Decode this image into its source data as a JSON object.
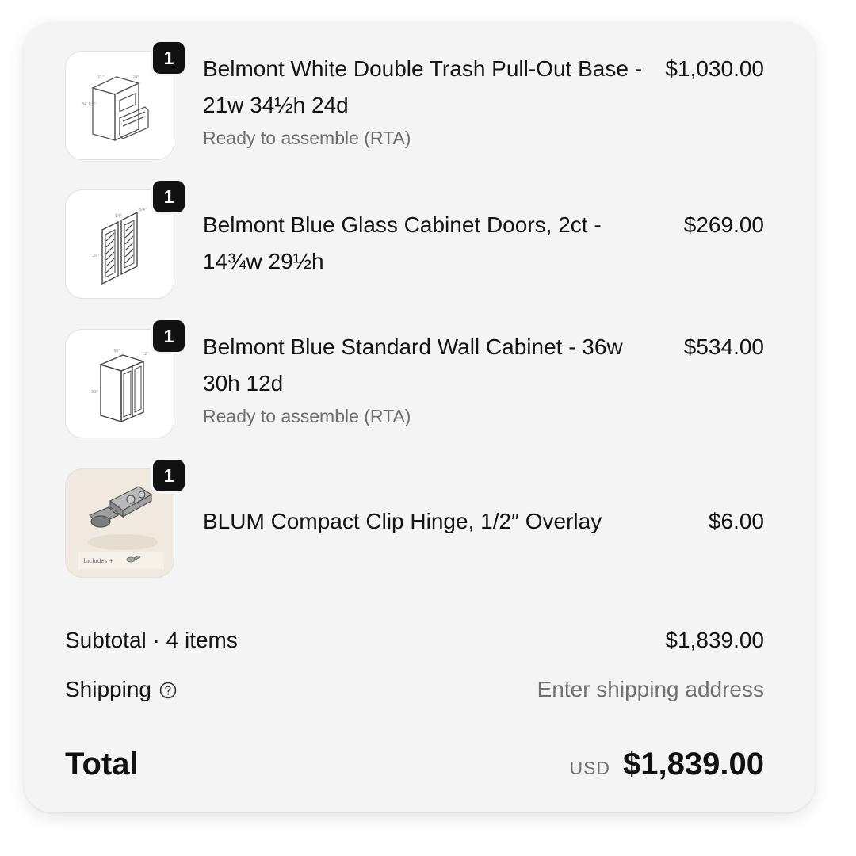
{
  "items": [
    {
      "quantity": "1",
      "name": "Belmont White Double Trash Pull-Out Base - 21w 34½h 24d",
      "variant": "Ready to assemble (RTA)",
      "price": "$1,030.00",
      "icon": "base-cabinet-icon"
    },
    {
      "quantity": "1",
      "name": "Belmont Blue Glass Cabinet Doors, 2ct - 14¾w 29½h",
      "variant": "",
      "price": "$269.00",
      "icon": "glass-doors-icon"
    },
    {
      "quantity": "1",
      "name": "Belmont Blue Standard Wall Cabinet - 36w 30h 12d",
      "variant": "Ready to assemble (RTA)",
      "price": "$534.00",
      "icon": "wall-cabinet-icon"
    },
    {
      "quantity": "1",
      "name": "BLUM Compact Clip Hinge, 1/2″ Overlay",
      "variant": "",
      "price": "$6.00",
      "icon": "hinge-icon",
      "thumbnail_caption": "Includes +"
    }
  ],
  "summary": {
    "subtotal_label": "Subtotal · 4 items",
    "subtotal_value": "$1,839.00",
    "shipping_label": "Shipping",
    "shipping_value": "Enter shipping address",
    "total_label": "Total",
    "currency": "USD",
    "total_value": "$1,839.00"
  },
  "colors": {
    "panel_background": "#f4f4f4",
    "badge_background": "#111111",
    "muted_text": "#707070"
  }
}
